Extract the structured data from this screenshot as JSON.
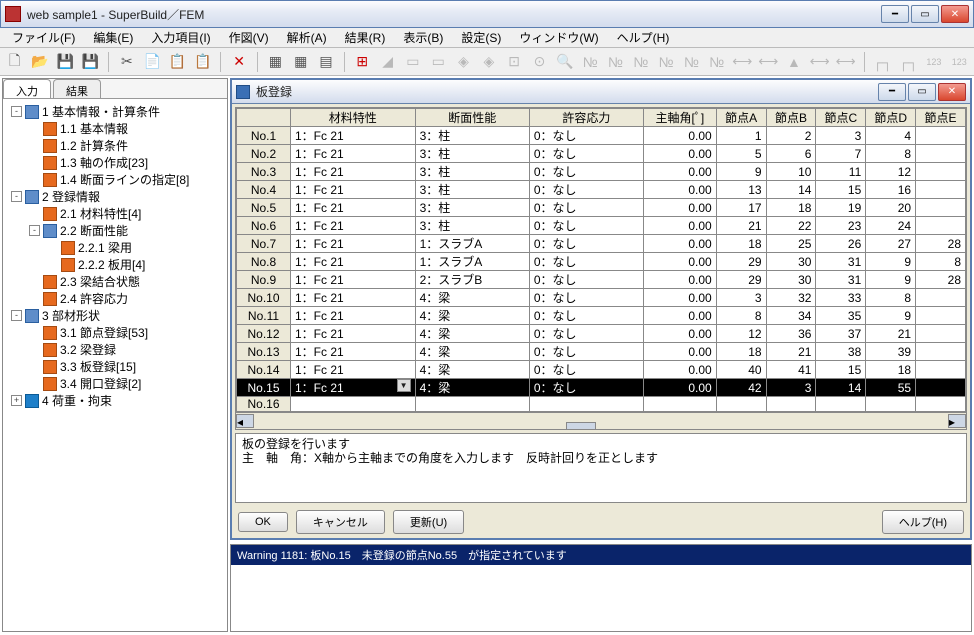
{
  "window": {
    "title": "web sample1 - SuperBuild／FEM"
  },
  "menu": [
    "ファイル(F)",
    "編集(E)",
    "入力項目(I)",
    "作図(V)",
    "解析(A)",
    "結果(R)",
    "表示(B)",
    "設定(S)",
    "ウィンドウ(W)",
    "ヘルプ(H)"
  ],
  "tabs": {
    "active": "入力",
    "inactive": "結果"
  },
  "tree": [
    {
      "lvl": 0,
      "tg": "-",
      "ic": "group",
      "label": "1 基本情報・計算条件"
    },
    {
      "lvl": 1,
      "tg": "",
      "ic": "sheet",
      "label": "1.1 基本情報"
    },
    {
      "lvl": 1,
      "tg": "",
      "ic": "sheet",
      "label": "1.2 計算条件"
    },
    {
      "lvl": 1,
      "tg": "",
      "ic": "sheet",
      "label": "1.3 軸の作成[23]"
    },
    {
      "lvl": 1,
      "tg": "",
      "ic": "sheet",
      "label": "1.4 断面ラインの指定[8]"
    },
    {
      "lvl": 0,
      "tg": "-",
      "ic": "group",
      "label": "2 登録情報"
    },
    {
      "lvl": 1,
      "tg": "",
      "ic": "sheet",
      "label": "2.1 材料特性[4]"
    },
    {
      "lvl": 1,
      "tg": "-",
      "ic": "group",
      "label": "2.2 断面性能"
    },
    {
      "lvl": 2,
      "tg": "",
      "ic": "sheet",
      "label": "2.2.1 梁用"
    },
    {
      "lvl": 2,
      "tg": "",
      "ic": "sheet",
      "label": "2.2.2 板用[4]"
    },
    {
      "lvl": 1,
      "tg": "",
      "ic": "sheet",
      "label": "2.3 梁結合状態"
    },
    {
      "lvl": 1,
      "tg": "",
      "ic": "sheet",
      "label": "2.4 許容応力"
    },
    {
      "lvl": 0,
      "tg": "-",
      "ic": "group",
      "label": "3 部材形状"
    },
    {
      "lvl": 1,
      "tg": "",
      "ic": "sheet",
      "label": "3.1 節点登録[53]"
    },
    {
      "lvl": 1,
      "tg": "",
      "ic": "sheet",
      "label": "3.2 梁登録"
    },
    {
      "lvl": 1,
      "tg": "",
      "ic": "sheet",
      "label": "3.3 板登録[15]"
    },
    {
      "lvl": 1,
      "tg": "",
      "ic": "sheet",
      "label": "3.4 開口登録[2]"
    },
    {
      "lvl": 0,
      "tg": "+",
      "ic": "sheetb",
      "label": "4 荷重・拘束"
    }
  ],
  "child": {
    "title": "板登録",
    "columns": [
      "",
      "材料特性",
      "断面性能",
      "許容応力",
      "主軸角[ﾟ]",
      "節点A",
      "節点B",
      "節点C",
      "節点D",
      "節点E"
    ],
    "rows": [
      {
        "no": "No.1",
        "mat": "1：Fc 21",
        "sec": "3：柱",
        "allow": "0：なし",
        "ang": "0.00",
        "a": "1",
        "b": "2",
        "c": "3",
        "d": "4",
        "e": ""
      },
      {
        "no": "No.2",
        "mat": "1：Fc 21",
        "sec": "3：柱",
        "allow": "0：なし",
        "ang": "0.00",
        "a": "5",
        "b": "6",
        "c": "7",
        "d": "8",
        "e": ""
      },
      {
        "no": "No.3",
        "mat": "1：Fc 21",
        "sec": "3：柱",
        "allow": "0：なし",
        "ang": "0.00",
        "a": "9",
        "b": "10",
        "c": "11",
        "d": "12",
        "e": ""
      },
      {
        "no": "No.4",
        "mat": "1：Fc 21",
        "sec": "3：柱",
        "allow": "0：なし",
        "ang": "0.00",
        "a": "13",
        "b": "14",
        "c": "15",
        "d": "16",
        "e": ""
      },
      {
        "no": "No.5",
        "mat": "1：Fc 21",
        "sec": "3：柱",
        "allow": "0：なし",
        "ang": "0.00",
        "a": "17",
        "b": "18",
        "c": "19",
        "d": "20",
        "e": ""
      },
      {
        "no": "No.6",
        "mat": "1：Fc 21",
        "sec": "3：柱",
        "allow": "0：なし",
        "ang": "0.00",
        "a": "21",
        "b": "22",
        "c": "23",
        "d": "24",
        "e": ""
      },
      {
        "no": "No.7",
        "mat": "1：Fc 21",
        "sec": "1：スラブA",
        "allow": "0：なし",
        "ang": "0.00",
        "a": "18",
        "b": "25",
        "c": "26",
        "d": "27",
        "e": "28"
      },
      {
        "no": "No.8",
        "mat": "1：Fc 21",
        "sec": "1：スラブA",
        "allow": "0：なし",
        "ang": "0.00",
        "a": "29",
        "b": "30",
        "c": "31",
        "d": "9",
        "e": "8"
      },
      {
        "no": "No.9",
        "mat": "1：Fc 21",
        "sec": "2：スラブB",
        "allow": "0：なし",
        "ang": "0.00",
        "a": "29",
        "b": "30",
        "c": "31",
        "d": "9",
        "e": "28"
      },
      {
        "no": "No.10",
        "mat": "1：Fc 21",
        "sec": "4：梁",
        "allow": "0：なし",
        "ang": "0.00",
        "a": "3",
        "b": "32",
        "c": "33",
        "d": "8",
        "e": ""
      },
      {
        "no": "No.11",
        "mat": "1：Fc 21",
        "sec": "4：梁",
        "allow": "0：なし",
        "ang": "0.00",
        "a": "8",
        "b": "34",
        "c": "35",
        "d": "9",
        "e": ""
      },
      {
        "no": "No.12",
        "mat": "1：Fc 21",
        "sec": "4：梁",
        "allow": "0：なし",
        "ang": "0.00",
        "a": "12",
        "b": "36",
        "c": "37",
        "d": "21",
        "e": ""
      },
      {
        "no": "No.13",
        "mat": "1：Fc 21",
        "sec": "4：梁",
        "allow": "0：なし",
        "ang": "0.00",
        "a": "18",
        "b": "21",
        "c": "38",
        "d": "39",
        "e": ""
      },
      {
        "no": "No.14",
        "mat": "1：Fc 21",
        "sec": "4：梁",
        "allow": "0：なし",
        "ang": "0.00",
        "a": "40",
        "b": "41",
        "c": "15",
        "d": "18",
        "e": ""
      },
      {
        "no": "No.15",
        "mat": "1：Fc 21",
        "sec": "4：梁",
        "allow": "0：なし",
        "ang": "0.00",
        "a": "42",
        "b": "3",
        "c": "14",
        "d": "55",
        "e": "",
        "sel": true,
        "dd": true
      },
      {
        "no": "No.16",
        "mat": "",
        "sec": "",
        "allow": "",
        "ang": "",
        "a": "",
        "b": "",
        "c": "",
        "d": "",
        "e": ""
      }
    ],
    "desc_l1": "板の登録を行います",
    "desc_l2": "主　軸　角：X軸から主軸までの角度を入力します　反時計回りを正とします",
    "buttons": {
      "ok": "OK",
      "cancel": "キャンセル",
      "update": "更新(U)",
      "help": "ヘルプ(H)"
    }
  },
  "status": "Warning 1181: 板No.15　未登録の節点No.55　が指定されています"
}
